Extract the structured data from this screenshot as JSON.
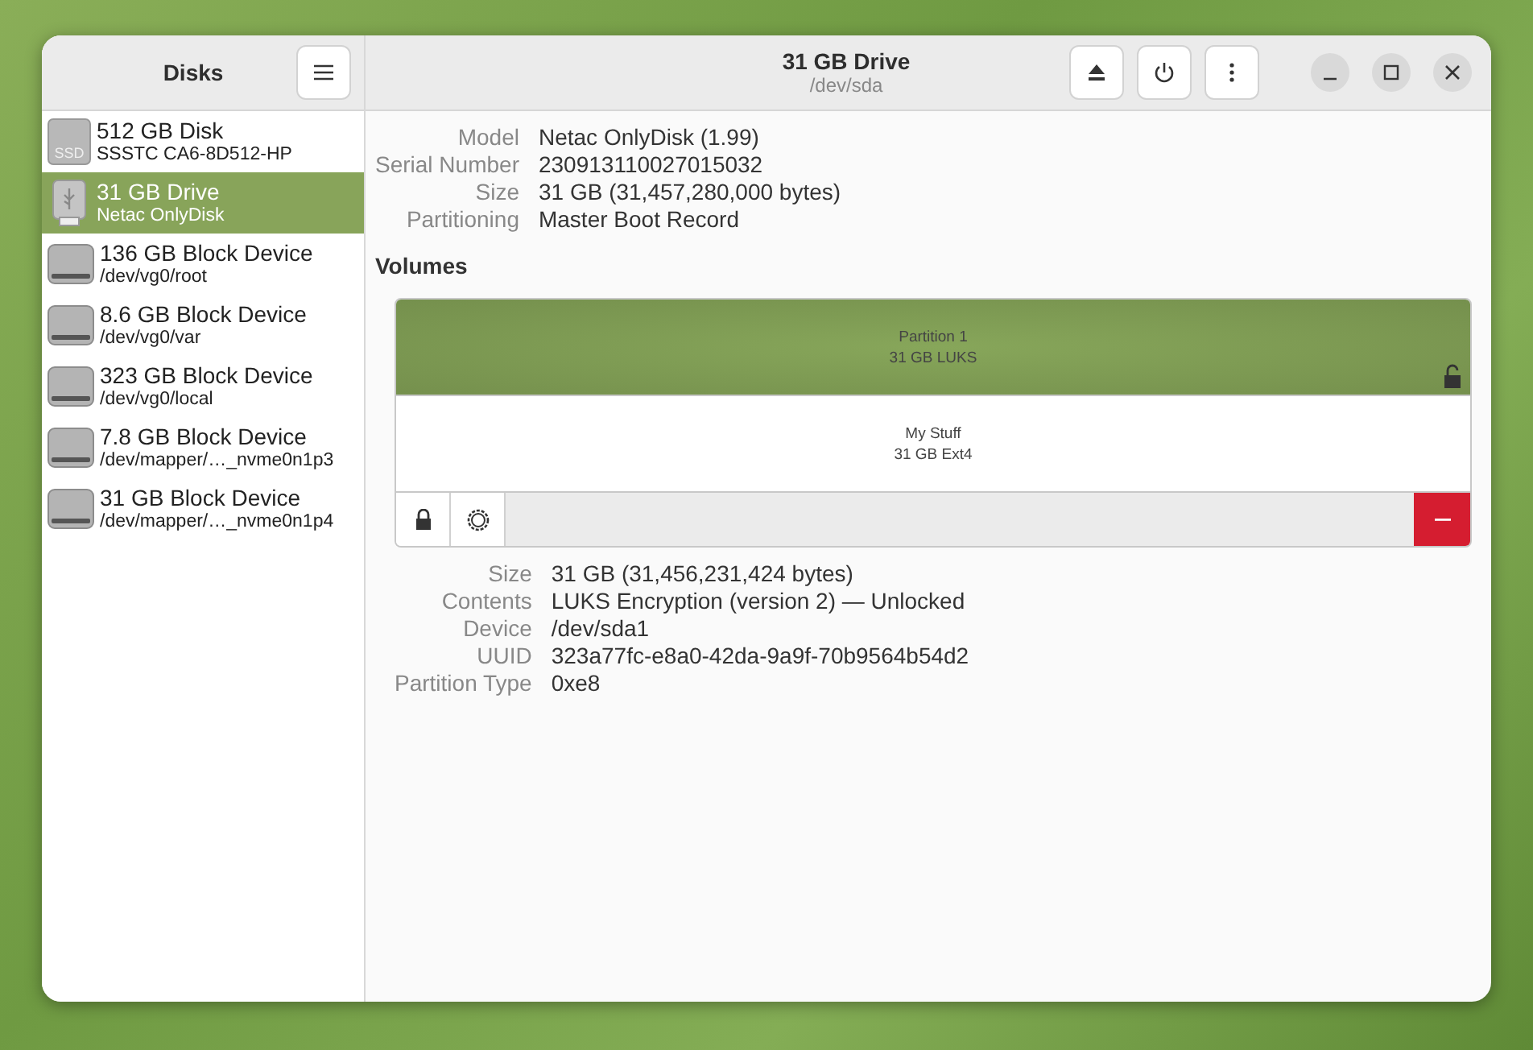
{
  "sidebar": {
    "title": "Disks",
    "items": [
      {
        "kind": "ssd",
        "badge": "SSD",
        "name": "512 GB Disk",
        "detail": "SSSTC CA6-8D512-HP",
        "selected": false
      },
      {
        "kind": "usb",
        "name": "31 GB Drive",
        "detail": "Netac OnlyDisk",
        "selected": true
      },
      {
        "kind": "hdd",
        "name": "136 GB Block Device",
        "detail": "/dev/vg0/root",
        "selected": false
      },
      {
        "kind": "hdd",
        "name": "8.6 GB Block Device",
        "detail": "/dev/vg0/var",
        "selected": false
      },
      {
        "kind": "hdd",
        "name": "323 GB Block Device",
        "detail": "/dev/vg0/local",
        "selected": false
      },
      {
        "kind": "hdd",
        "name": "7.8 GB Block Device",
        "detail": "/dev/mapper/…_nvme0n1p3",
        "selected": false
      },
      {
        "kind": "hdd",
        "name": "31 GB Block Device",
        "detail": "/dev/mapper/…_nvme0n1p4",
        "selected": false
      }
    ]
  },
  "header": {
    "title": "31 GB Drive",
    "subtitle": "/dev/sda"
  },
  "drive_details": [
    {
      "label": "Model",
      "value": "Netac OnlyDisk (1.99)"
    },
    {
      "label": "Serial Number",
      "value": "230913110027015032"
    },
    {
      "label": "Size",
      "value": "31 GB (31,457,280,000 bytes)"
    },
    {
      "label": "Partitioning",
      "value": "Master Boot Record"
    }
  ],
  "volumes": {
    "heading": "Volumes",
    "partition": {
      "name": "Partition 1",
      "info": "31 GB LUKS",
      "selected": true,
      "unlocked": true
    },
    "content": {
      "name": "My Stuff",
      "info": "31 GB Ext4",
      "selected": false
    }
  },
  "volume_details": [
    {
      "label": "Size",
      "value": "31 GB (31,456,231,424 bytes)"
    },
    {
      "label": "Contents",
      "value": "LUKS Encryption (version 2) — Unlocked"
    },
    {
      "label": "Device",
      "value": "/dev/sda1"
    },
    {
      "label": "UUID",
      "value": "323a77fc-e8a0-42da-9a9f-70b9564b54d2"
    },
    {
      "label": "Partition Type",
      "value": "0xe8"
    }
  ]
}
